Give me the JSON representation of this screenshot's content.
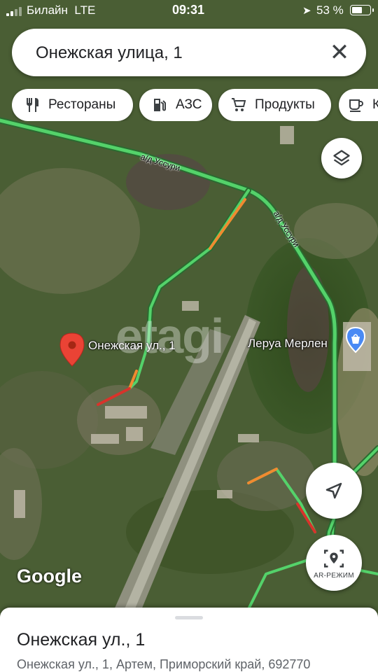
{
  "status_bar": {
    "carrier": "Билайн",
    "network": "LTE",
    "time": "09:31",
    "battery": "53 %"
  },
  "search": {
    "query": "Онежская улица, 1",
    "close_icon": "close-icon"
  },
  "chips": [
    {
      "label": "Рестораны",
      "icon": "restaurant-icon"
    },
    {
      "label": "АЗС",
      "icon": "gas-station-icon"
    },
    {
      "label": "Продукты",
      "icon": "cart-icon"
    },
    {
      "label": "К",
      "icon": "coffee-icon"
    }
  ],
  "map": {
    "pin_label": "Онежская ул., 1",
    "poi_label": "Леруа Мерлен",
    "road_labels": [
      "а/д Уссури",
      "а/д Уссури"
    ],
    "watermark": "etagi",
    "attribution": "Google"
  },
  "buttons": {
    "layers": "layers-icon",
    "my_location": "navigation-arrow-icon",
    "ar_label": "AR-РЕЖИМ"
  },
  "sheet": {
    "title": "Онежская ул., 1",
    "address": "Онежская ул., 1, Артем, Приморский край, 692770"
  },
  "colors": {
    "traffic_green": "#54d26a",
    "traffic_orange": "#f08a30",
    "traffic_red": "#d8332b",
    "pin_red": "#ea4335",
    "poi_blue": "#4a8af4"
  }
}
